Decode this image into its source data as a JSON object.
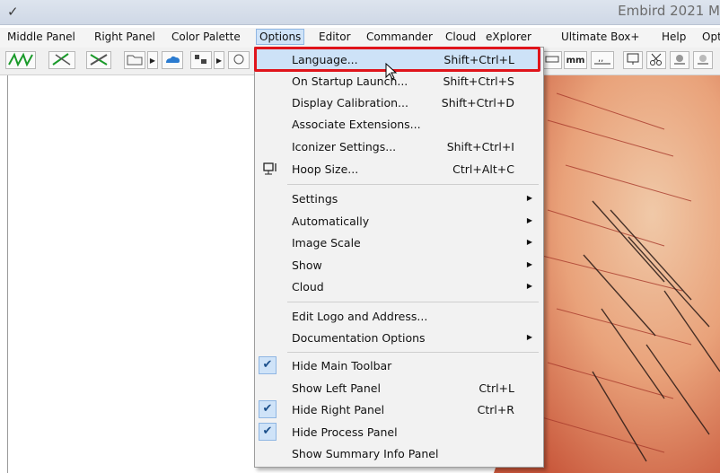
{
  "title_bar": {
    "app_title": "Embird 2021 M"
  },
  "menubar": {
    "items": [
      {
        "label": "Middle Panel"
      },
      {
        "label": "Right Panel"
      },
      {
        "label": "Color Palette"
      },
      {
        "label": "Options"
      },
      {
        "label": "Editor"
      },
      {
        "label": "Commander"
      },
      {
        "label": "Cloud"
      },
      {
        "label": "eXplorer"
      },
      {
        "label": "Ultimate Box+"
      },
      {
        "label": "Help"
      },
      {
        "label": "Opt"
      }
    ]
  },
  "toolbar": {
    "unit_mm": "mm"
  },
  "options_menu": {
    "items": [
      {
        "label": "Language...",
        "shortcut": "Shift+Ctrl+L"
      },
      {
        "label": "On Startup Launch...",
        "shortcut": "Shift+Ctrl+S"
      },
      {
        "label": "Display Calibration...",
        "shortcut": "Shift+Ctrl+D"
      },
      {
        "label": "Associate Extensions...",
        "shortcut": ""
      },
      {
        "label": "Iconizer Settings...",
        "shortcut": "Shift+Ctrl+I"
      },
      {
        "label": "Hoop Size...",
        "shortcut": "Ctrl+Alt+C"
      },
      {
        "label": "Settings",
        "shortcut": ""
      },
      {
        "label": "Automatically",
        "shortcut": ""
      },
      {
        "label": "Image Scale",
        "shortcut": ""
      },
      {
        "label": "Show",
        "shortcut": ""
      },
      {
        "label": "Cloud",
        "shortcut": ""
      },
      {
        "label": "Edit Logo and Address...",
        "shortcut": ""
      },
      {
        "label": "Documentation Options",
        "shortcut": ""
      },
      {
        "label": "Hide Main Toolbar",
        "shortcut": ""
      },
      {
        "label": "Show Left Panel",
        "shortcut": "Ctrl+L"
      },
      {
        "label": "Hide Right Panel",
        "shortcut": "Ctrl+R"
      },
      {
        "label": "Hide Process Panel",
        "shortcut": ""
      },
      {
        "label": "Show Summary Info Panel",
        "shortcut": ""
      }
    ]
  },
  "colors": {
    "highlight_box": "#e0141b",
    "menu_hover": "#cde2f7",
    "menu_bg": "#f2f2f2"
  }
}
